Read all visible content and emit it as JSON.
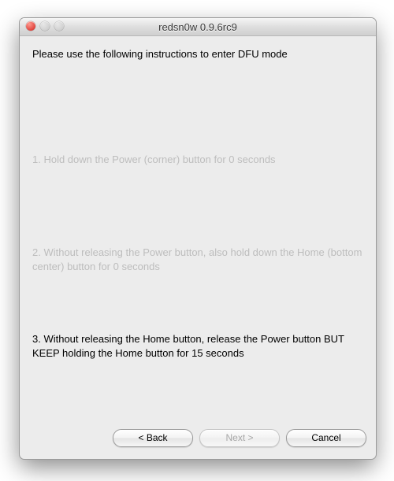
{
  "window": {
    "title": "redsn0w 0.9.6rc9"
  },
  "content": {
    "header": "Please use the following instructions to enter DFU mode",
    "steps": {
      "s1": "1. Hold down the Power (corner) button for 0 seconds",
      "s2": "2. Without releasing the Power button, also hold down the Home (bottom center) button for 0 seconds",
      "s3": "3. Without releasing the Home button, release the Power button BUT KEEP holding the Home button for 15 seconds"
    }
  },
  "buttons": {
    "back": "< Back",
    "next": "Next >",
    "cancel": "Cancel"
  }
}
